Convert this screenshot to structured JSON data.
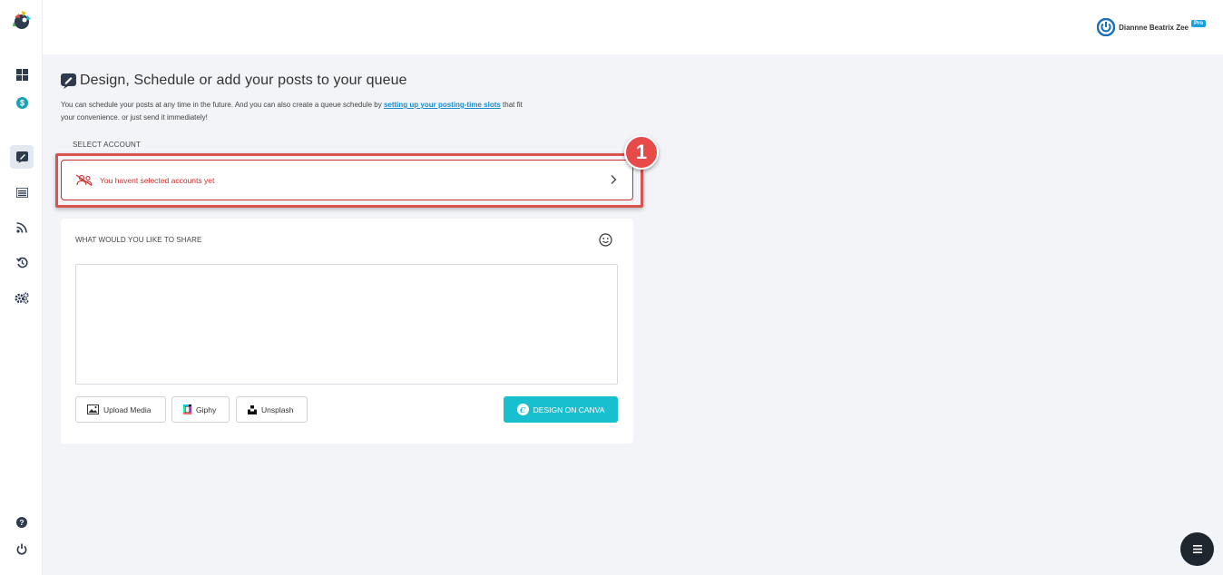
{
  "user": {
    "name": "Diannne Beatrix Zee",
    "badge": "Pro"
  },
  "page": {
    "title": "Design, Schedule or add your posts to your queue",
    "subtitle_before": "You can schedule your posts at any time in the future. And you can also create a queue schedule by ",
    "subtitle_link": "setting up your posting-time slots",
    "subtitle_after": " that fit your convenience. or just send it immediately!"
  },
  "account": {
    "label": "SELECT ACCOUNT",
    "empty_message": "You havent selected accounts yet",
    "annotation_number": "1"
  },
  "compose": {
    "label": "WHAT WOULD YOU LIKE TO SHARE",
    "text": ""
  },
  "buttons": {
    "upload": "Upload Media",
    "giphy": "Giphy",
    "unsplash": "Unsplash",
    "canva": "DESIGN ON CANVA"
  },
  "colors": {
    "accent_teal": "#17bfcf",
    "error_red": "#c9302c",
    "annotation_red": "#e84a4a",
    "pro_blue": "#1aa1d9"
  },
  "icons": [
    "app-logo-icon",
    "dashboard-icon",
    "dollar-icon",
    "compose-icon",
    "list-icon",
    "rss-icon",
    "history-icon",
    "settings-icon",
    "help-icon",
    "power-icon",
    "no-accounts-icon",
    "chevron-right-icon",
    "emoji-icon",
    "image-icon",
    "giphy-icon",
    "unsplash-icon",
    "canva-icon",
    "menu-icon"
  ]
}
